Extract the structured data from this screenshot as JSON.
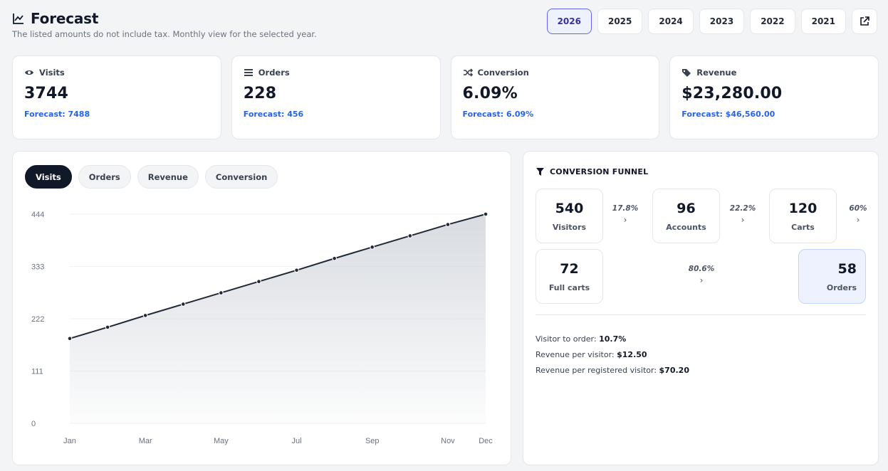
{
  "header": {
    "title": "Forecast",
    "subtitle": "The listed amounts do not include tax. Monthly view for the selected year.",
    "title_icon": "line-chart-icon",
    "years": [
      "2026",
      "2025",
      "2024",
      "2023",
      "2022",
      "2021"
    ],
    "active_year": "2026",
    "export_icon": "external-link-icon"
  },
  "cards": [
    {
      "label": "Visits",
      "icon": "eye-icon",
      "value": "3744",
      "forecast": "Forecast: 7488"
    },
    {
      "label": "Orders",
      "icon": "list-icon",
      "value": "228",
      "forecast": "Forecast: 456"
    },
    {
      "label": "Conversion",
      "icon": "shuffle-icon",
      "value": "6.09%",
      "forecast": "Forecast: 6.09%"
    },
    {
      "label": "Revenue",
      "icon": "tags-icon",
      "value": "$23,280.00",
      "forecast": "Forecast: $46,560.00"
    }
  ],
  "chart_tabs": [
    "Visits",
    "Orders",
    "Revenue",
    "Conversion"
  ],
  "active_chart_tab": "Visits",
  "chart_data": {
    "type": "area",
    "x": [
      "Jan",
      "Feb",
      "Mar",
      "Apr",
      "May",
      "Jun",
      "Jul",
      "Aug",
      "Sep",
      "Oct",
      "Nov",
      "Dec"
    ],
    "x_tick_labels": [
      "Jan",
      "Mar",
      "May",
      "Jul",
      "Sep",
      "Nov",
      "Dec"
    ],
    "series": [
      {
        "values": [
          180,
          204,
          229,
          253,
          277,
          301,
          325,
          350,
          374,
          398,
          422,
          444
        ]
      }
    ],
    "y_ticks": [
      0,
      111,
      222,
      333,
      444
    ],
    "ylim": [
      0,
      444
    ],
    "grid": true,
    "line_color": "#1f2937",
    "fill_color": "#d1d5db"
  },
  "funnel": {
    "title": "CONVERSION FUNNEL",
    "icon": "filter-icon",
    "steps": [
      {
        "value": "540",
        "label": "Visitors"
      },
      {
        "value": "96",
        "label": "Accounts"
      },
      {
        "value": "120",
        "label": "Carts"
      },
      {
        "value": "72",
        "label": "Full carts"
      },
      {
        "value": "58",
        "label": "Orders"
      }
    ],
    "rates": [
      "17.8%",
      "22.2%",
      "60%",
      "80.6%"
    ],
    "chevron": "›",
    "stats": [
      {
        "label": "Visitor to order: ",
        "value": "10.7%"
      },
      {
        "label": "Revenue per visitor: ",
        "value": "$12.50"
      },
      {
        "label": "Revenue per registered visitor: ",
        "value": "$70.20"
      }
    ]
  },
  "colors": {
    "accent": "#2563eb",
    "active_year_border": "#6366f1",
    "dark": "#111827"
  }
}
